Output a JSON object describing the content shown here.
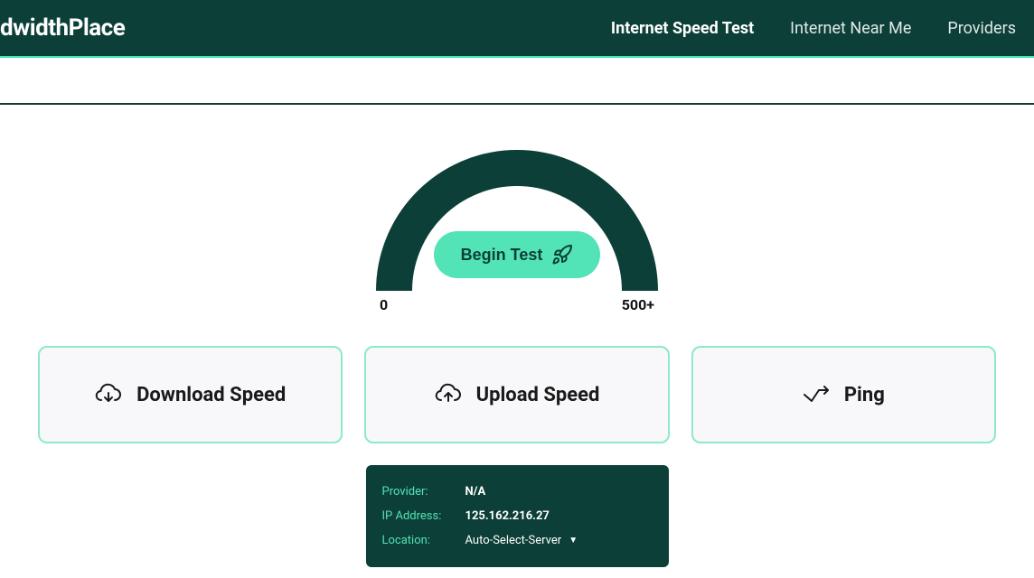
{
  "header": {
    "logo": "dwidthPlace",
    "nav": {
      "speed_test": "Internet Speed Test",
      "near_me": "Internet Near Me",
      "providers": "Providers"
    }
  },
  "gauge": {
    "begin_label": "Begin Test",
    "min_label": "0",
    "max_label": "500+"
  },
  "cards": {
    "download": "Download Speed",
    "upload": "Upload Speed",
    "ping": "Ping"
  },
  "info": {
    "provider_label": "Provider:",
    "provider_value": "N/A",
    "ip_label": "IP Address:",
    "ip_value": "125.162.216.27",
    "location_label": "Location:",
    "location_value": "Auto-Select-Server"
  }
}
